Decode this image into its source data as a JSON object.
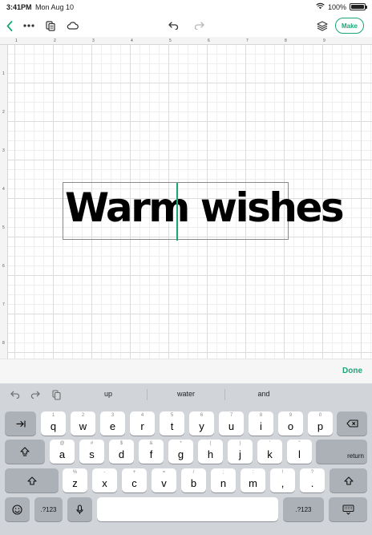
{
  "status_bar": {
    "time": "3:41PM",
    "date": "Mon Aug 10",
    "battery": "100%"
  },
  "toolbar": {
    "make_label": "Make"
  },
  "canvas": {
    "ruler_top": [
      "1",
      "2",
      "3",
      "4",
      "5",
      "6",
      "7",
      "8",
      "9"
    ],
    "ruler_left": [
      "1",
      "2",
      "3",
      "4",
      "5",
      "6",
      "7",
      "8"
    ],
    "text": "Warm wishes"
  },
  "done_bar": {
    "done_label": "Done"
  },
  "keyboard": {
    "suggestions": [
      "up",
      "water",
      "and"
    ],
    "row1": [
      {
        "hint": "1",
        "label": "q"
      },
      {
        "hint": "2",
        "label": "w"
      },
      {
        "hint": "3",
        "label": "e"
      },
      {
        "hint": "4",
        "label": "r"
      },
      {
        "hint": "5",
        "label": "t"
      },
      {
        "hint": "6",
        "label": "y"
      },
      {
        "hint": "7",
        "label": "u"
      },
      {
        "hint": "8",
        "label": "i"
      },
      {
        "hint": "9",
        "label": "o"
      },
      {
        "hint": "0",
        "label": "p"
      }
    ],
    "row2": [
      {
        "hint": "@",
        "label": "a"
      },
      {
        "hint": "#",
        "label": "s"
      },
      {
        "hint": "$",
        "label": "d"
      },
      {
        "hint": "&",
        "label": "f"
      },
      {
        "hint": "*",
        "label": "g"
      },
      {
        "hint": "(",
        "label": "h"
      },
      {
        "hint": ")",
        "label": "j"
      },
      {
        "hint": "'",
        "label": "k"
      },
      {
        "hint": "\"",
        "label": "l"
      }
    ],
    "row3": [
      {
        "hint": "%",
        "label": "z"
      },
      {
        "hint": "-",
        "label": "x"
      },
      {
        "hint": "+",
        "label": "c"
      },
      {
        "hint": "=",
        "label": "v"
      },
      {
        "hint": "/",
        "label": "b"
      },
      {
        "hint": ";",
        "label": "n"
      },
      {
        "hint": ":",
        "label": "m"
      },
      {
        "hint": "!",
        "label": ","
      },
      {
        "hint": "?",
        "label": "."
      }
    ],
    "return_label": "return",
    "numbers_label": ".?123"
  }
}
